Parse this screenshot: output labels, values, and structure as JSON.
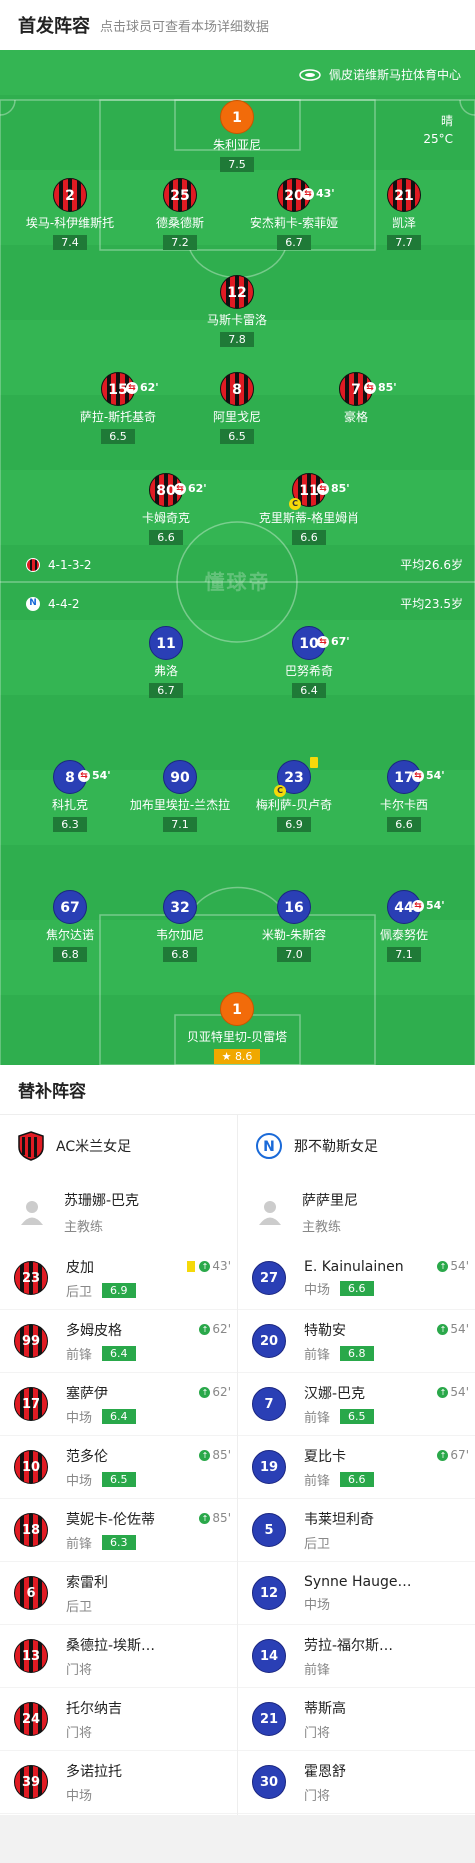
{
  "header": {
    "title": "首发阵容",
    "subtitle": "点击球员可查看本场详细数据"
  },
  "venue": "佩皮诺维斯马拉体育中心",
  "weather": {
    "condition": "晴",
    "temp": "25°C"
  },
  "watermark": "懂球帝",
  "home_team": {
    "formation": "4-1-3-2",
    "avg_age": "平均26.6岁"
  },
  "away_team": {
    "formation": "4-4-2",
    "avg_age": "平均23.5岁"
  },
  "home_lineup": [
    {
      "num": "1",
      "name": "朱利亚尼",
      "rating": "7.5",
      "gk": true
    },
    {
      "num": "2",
      "name": "埃马-科伊维斯托",
      "rating": "7.4"
    },
    {
      "num": "25",
      "name": "德桑德斯",
      "rating": "7.2"
    },
    {
      "num": "20",
      "name": "安杰莉卡-索菲娅",
      "rating": "6.7",
      "sub": "43'"
    },
    {
      "num": "21",
      "name": "凯泽",
      "rating": "7.7"
    },
    {
      "num": "12",
      "name": "马斯卡雷洛",
      "rating": "7.8"
    },
    {
      "num": "15",
      "name": "萨拉-斯托基奇",
      "rating": "6.5",
      "sub": "62'"
    },
    {
      "num": "8",
      "name": "阿里戈尼",
      "rating": "6.5"
    },
    {
      "num": "7",
      "name": "豪格",
      "rating": "",
      "sub": "85'"
    },
    {
      "num": "80",
      "name": "卡姆奇克",
      "rating": "6.6",
      "sub": "62'"
    },
    {
      "num": "11",
      "name": "克里斯蒂-格里姆肖",
      "rating": "6.6",
      "sub": "85'",
      "captain": true
    }
  ],
  "away_lineup": [
    {
      "num": "11",
      "name": "弗洛",
      "rating": "6.7"
    },
    {
      "num": "10",
      "name": "巴努希奇",
      "rating": "6.4",
      "sub": "67'"
    },
    {
      "num": "8",
      "name": "科扎克",
      "rating": "6.3",
      "sub": "54'"
    },
    {
      "num": "90",
      "name": "加布里埃拉-兰杰拉",
      "rating": "7.1"
    },
    {
      "num": "23",
      "name": "梅利萨-贝卢奇",
      "rating": "6.9",
      "captain": true,
      "yellow": true
    },
    {
      "num": "17",
      "name": "卡尔卡西",
      "rating": "6.6",
      "sub": "54'"
    },
    {
      "num": "67",
      "name": "焦尔达诺",
      "rating": "6.8"
    },
    {
      "num": "32",
      "name": "韦尔加尼",
      "rating": "6.8"
    },
    {
      "num": "16",
      "name": "米勒-朱斯容",
      "rating": "7.0"
    },
    {
      "num": "44",
      "name": "佩泰努佐",
      "rating": "7.1",
      "sub": "54'"
    },
    {
      "num": "1",
      "name": "贝亚特里切-贝雷塔",
      "rating": "8.6",
      "gk": true,
      "mvp": true
    }
  ],
  "subs_title": "替补阵容",
  "home_subs": {
    "team": "AC米兰女足",
    "coach": {
      "name": "苏珊娜-巴克",
      "role": "主教练"
    },
    "players": [
      {
        "num": "23",
        "name": "皮加",
        "pos": "后卫",
        "rating": "6.9",
        "in": "43'",
        "yellow": true
      },
      {
        "num": "99",
        "name": "多姆皮格",
        "pos": "前锋",
        "rating": "6.4",
        "in": "62'"
      },
      {
        "num": "17",
        "name": "塞萨伊",
        "pos": "中场",
        "rating": "6.4",
        "in": "62'"
      },
      {
        "num": "10",
        "name": "范多伦",
        "pos": "中场",
        "rating": "6.5",
        "in": "85'"
      },
      {
        "num": "18",
        "name": "莫妮卡-伦佐蒂",
        "pos": "前锋",
        "rating": "6.3",
        "in": "85'"
      },
      {
        "num": "6",
        "name": "索雷利",
        "pos": "后卫",
        "rating": "",
        "in": ""
      },
      {
        "num": "13",
        "name": "桑德拉-埃斯…",
        "pos": "门将",
        "rating": "",
        "in": ""
      },
      {
        "num": "24",
        "name": "托尔纳吉",
        "pos": "门将",
        "rating": "",
        "in": ""
      },
      {
        "num": "39",
        "name": "多诺拉托",
        "pos": "中场",
        "rating": "",
        "in": ""
      }
    ]
  },
  "away_subs": {
    "team": "那不勒斯女足",
    "coach": {
      "name": "萨萨里尼",
      "role": "主教练"
    },
    "players": [
      {
        "num": "27",
        "name": "E. Kainulainen",
        "pos": "中场",
        "rating": "6.6",
        "in": "54'"
      },
      {
        "num": "20",
        "name": "特勒安",
        "pos": "前锋",
        "rating": "6.8",
        "in": "54'"
      },
      {
        "num": "7",
        "name": "汉娜-巴克",
        "pos": "前锋",
        "rating": "6.5",
        "in": "54'"
      },
      {
        "num": "19",
        "name": "夏比卡",
        "pos": "前锋",
        "rating": "6.6",
        "in": "67'"
      },
      {
        "num": "5",
        "name": "韦莱坦利奇",
        "pos": "后卫",
        "rating": "",
        "in": ""
      },
      {
        "num": "12",
        "name": "Synne Hauge…",
        "pos": "中场",
        "rating": "",
        "in": ""
      },
      {
        "num": "14",
        "name": "劳拉-福尔斯…",
        "pos": "前锋",
        "rating": "",
        "in": ""
      },
      {
        "num": "21",
        "name": "蒂斯高",
        "pos": "门将",
        "rating": "",
        "in": ""
      },
      {
        "num": "30",
        "name": "霍恩舒",
        "pos": "门将",
        "rating": "",
        "in": ""
      }
    ]
  }
}
